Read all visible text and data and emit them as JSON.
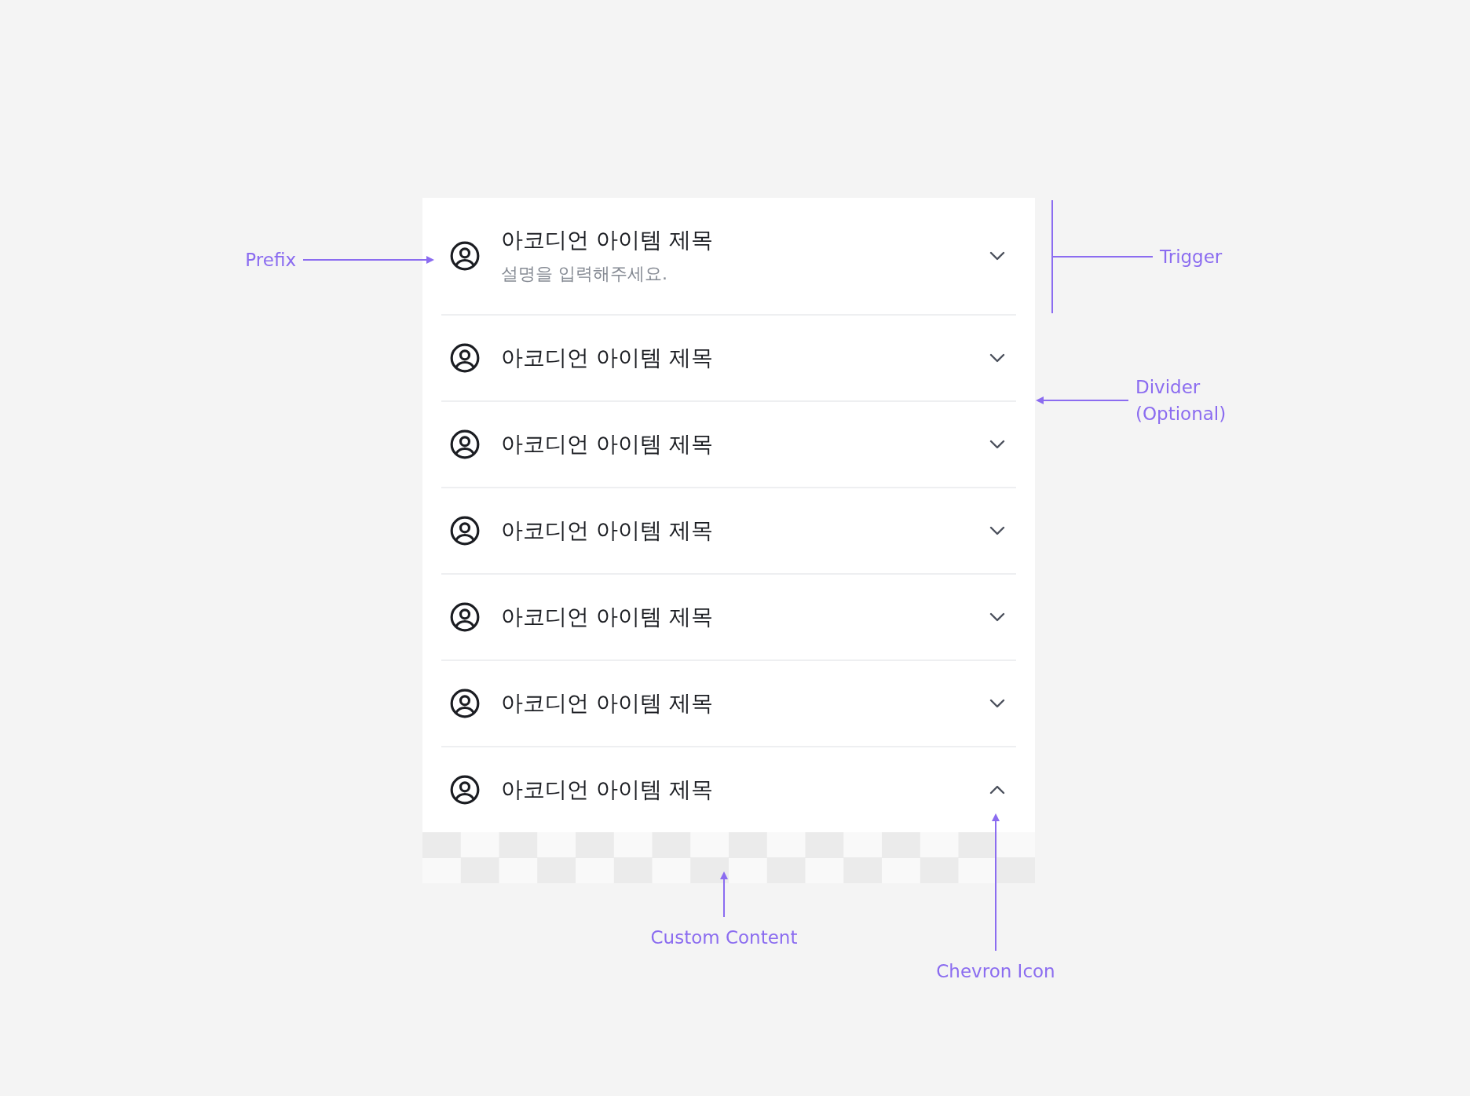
{
  "accordion": {
    "items": [
      {
        "title": "아코디언 아이템 제목",
        "description": "설명을 입력해주세요.",
        "expanded": false
      },
      {
        "title": "아코디언 아이템 제목",
        "expanded": false
      },
      {
        "title": "아코디언 아이템 제목",
        "expanded": false
      },
      {
        "title": "아코디언 아이템 제목",
        "expanded": false
      },
      {
        "title": "아코디언 아이템 제목",
        "expanded": false
      },
      {
        "title": "아코디언 아이템 제목",
        "expanded": false
      },
      {
        "title": "아코디언 아이템 제목",
        "expanded": true
      }
    ]
  },
  "annotations": [
    {
      "kind": "prefix",
      "label": "Prefix"
    },
    {
      "kind": "trigger",
      "label": "Trigger"
    },
    {
      "kind": "divider",
      "label": "Divider (Optional)"
    },
    {
      "kind": "content",
      "label": "Custom Content"
    },
    {
      "kind": "chevron",
      "label": "Chevron Icon"
    }
  ]
}
